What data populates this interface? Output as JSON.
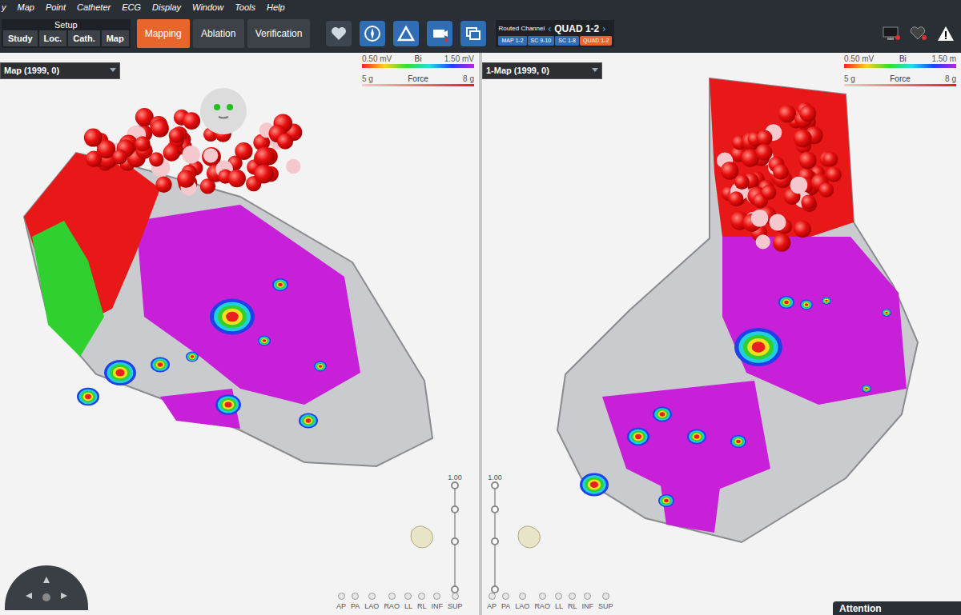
{
  "menu": [
    "y",
    "Map",
    "Point",
    "Catheter",
    "ECG",
    "Display",
    "Window",
    "Tools",
    "Help"
  ],
  "setup": {
    "title": "Setup",
    "tabs": [
      {
        "label": "Study",
        "selected": false
      },
      {
        "label": "Loc.",
        "selected": false
      },
      {
        "label": "Cath.",
        "selected": false
      },
      {
        "label": "Map",
        "selected": false
      }
    ]
  },
  "modes": [
    {
      "label": "Mapping",
      "selected": true
    },
    {
      "label": "Ablation",
      "selected": false
    },
    {
      "label": "Verification",
      "selected": false
    }
  ],
  "routed_channel": {
    "label": "Routed Channel",
    "prev": "‹",
    "value": "QUAD 1-2",
    "next": "›",
    "channels": [
      {
        "label": "MAP 1-2",
        "selected": false
      },
      {
        "label": "SC 9-10",
        "selected": false
      },
      {
        "label": "SC 1-8",
        "selected": false
      },
      {
        "label": "QUAD 1-2",
        "selected": true
      }
    ]
  },
  "panels": [
    {
      "title": "Map (1999, 0)",
      "bi_min": "0.50 mV",
      "bi_label": "Bi",
      "bi_max": "1.50 mV",
      "force_min": "5 g",
      "force_label": "Force",
      "force_max": "8 g",
      "scale": "1.00",
      "views": [
        "AP",
        "PA",
        "LAO",
        "RAO",
        "LL",
        "RL",
        "INF",
        "SUP"
      ]
    },
    {
      "title": "1-Map (1999, 0)",
      "bi_min": "0.50 mV",
      "bi_label": "Bi",
      "bi_max": "1.50 m",
      "force_min": "5 g",
      "force_label": "Force",
      "force_max": "8 g",
      "scale": "1.00",
      "views": [
        "AP",
        "PA",
        "LAO",
        "RAO",
        "LL",
        "RL",
        "INF",
        "SUP"
      ]
    }
  ],
  "attention": "Attention"
}
